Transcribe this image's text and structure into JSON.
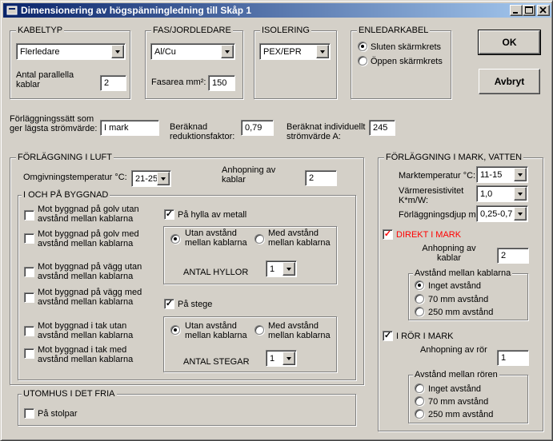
{
  "window": {
    "title": "Dimensionering av högspänningledning till Skåp 1",
    "icon": "app-icon",
    "controls": [
      "minimize-icon",
      "maximize-icon",
      "close-icon"
    ]
  },
  "kabeltyp": {
    "legend": "KABELTYP",
    "value": "Flerledare",
    "parallel_label": "Antal parallella kablar",
    "parallel_value": "2"
  },
  "fas": {
    "legend": "FAS/JORDLEDARE",
    "value": "Al/Cu",
    "area_label": "Fasarea mm²:",
    "area_value": "150"
  },
  "isolering": {
    "legend": "ISOLERING",
    "value": "PEX/EPR"
  },
  "enledar": {
    "legend": "ENLEDARKABEL",
    "option1": "Sluten skärmkrets",
    "option2": "Öppen skärmkrets"
  },
  "buttons": {
    "ok": "OK",
    "cancel": "Avbryt"
  },
  "summary": {
    "method_label": "Förläggningssätt som ger lägsta strömvärde:",
    "method_value": "I mark",
    "factor_label": "Beräknad reduktionsfaktor:",
    "factor_value": "0,79",
    "current_label": "Beräknat individuellt strömvärde A:",
    "current_value": "245"
  },
  "luft": {
    "legend": "FÖRLÄGGNING I LUFT",
    "temp_label": "Omgivningstemperatur °C:",
    "temp_value": "21-25",
    "anhop_label": "Anhopning av kablar",
    "anhop_value": "2",
    "byggnad": {
      "legend": "I OCH PÅ BYGGNAD",
      "items": [
        "Mot byggnad på golv utan avstånd mellan kablarna",
        "Mot byggnad på golv med avstånd mellan kablarna",
        "Mot byggnad på vägg utan avstånd mellan kablarna",
        "Mot byggnad på vägg med avstånd mellan kablarna",
        "Mot byggnad i tak utan avstånd mellan kablarna",
        "Mot byggnad i tak med avstånd mellan kablarna"
      ],
      "hylla": {
        "label": "På hylla av metall",
        "option1": "Utan avstånd mellan kablarna",
        "option2": "Med avstånd mellan kablarna",
        "count_label": "ANTAL HYLLOR",
        "count_value": "1"
      },
      "stege": {
        "label": "På stege",
        "option1": "Utan avstånd mellan kablarna",
        "option2": "Med avstånd mellan kablarna",
        "count_label": "ANTAL STEGAR",
        "count_value": "1"
      }
    }
  },
  "utomhus": {
    "legend": "UTOMHUS I DET FRIA",
    "stolpar": "På stolpar"
  },
  "mark": {
    "legend": "FÖRLÄGGNING I MARK, VATTEN",
    "temp_label": "Marktemperatur °C:",
    "temp_value": "11-15",
    "resist_label": "Värmeresistivitet K*m/W:",
    "resist_value": "1,0",
    "depth_label": "Förläggningsdjup m:",
    "depth_value": "0,25-0,7",
    "direkt": {
      "label": "DIREKT I MARK",
      "anhop_label": "Anhopning av kablar",
      "anhop_value": "2",
      "distance_legend": "Avstånd mellan kablarna",
      "options": [
        "Inget avstånd",
        "70 mm avstånd",
        "250 mm avstånd"
      ]
    },
    "ror": {
      "label": "I RÖR I MARK",
      "anhop_label": "Anhopning av rör",
      "anhop_value": "1",
      "distance_legend": "Avstånd mellan rören",
      "options": [
        "Inget avstånd",
        "70 mm avstånd",
        "250 mm avstånd"
      ]
    }
  }
}
